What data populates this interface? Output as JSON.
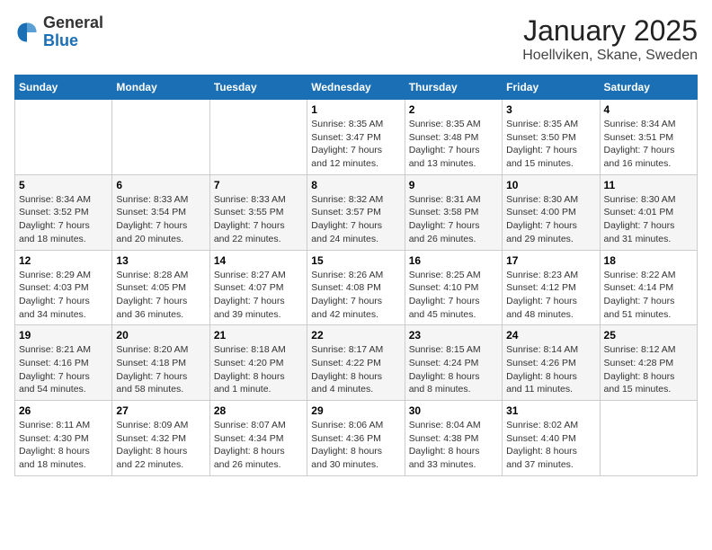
{
  "logo": {
    "general": "General",
    "blue": "Blue"
  },
  "title": "January 2025",
  "subtitle": "Hoellviken, Skane, Sweden",
  "weekdays": [
    "Sunday",
    "Monday",
    "Tuesday",
    "Wednesday",
    "Thursday",
    "Friday",
    "Saturday"
  ],
  "weeks": [
    [
      {
        "day": "",
        "content": ""
      },
      {
        "day": "",
        "content": ""
      },
      {
        "day": "",
        "content": ""
      },
      {
        "day": "1",
        "content": "Sunrise: 8:35 AM\nSunset: 3:47 PM\nDaylight: 7 hours\nand 12 minutes."
      },
      {
        "day": "2",
        "content": "Sunrise: 8:35 AM\nSunset: 3:48 PM\nDaylight: 7 hours\nand 13 minutes."
      },
      {
        "day": "3",
        "content": "Sunrise: 8:35 AM\nSunset: 3:50 PM\nDaylight: 7 hours\nand 15 minutes."
      },
      {
        "day": "4",
        "content": "Sunrise: 8:34 AM\nSunset: 3:51 PM\nDaylight: 7 hours\nand 16 minutes."
      }
    ],
    [
      {
        "day": "5",
        "content": "Sunrise: 8:34 AM\nSunset: 3:52 PM\nDaylight: 7 hours\nand 18 minutes."
      },
      {
        "day": "6",
        "content": "Sunrise: 8:33 AM\nSunset: 3:54 PM\nDaylight: 7 hours\nand 20 minutes."
      },
      {
        "day": "7",
        "content": "Sunrise: 8:33 AM\nSunset: 3:55 PM\nDaylight: 7 hours\nand 22 minutes."
      },
      {
        "day": "8",
        "content": "Sunrise: 8:32 AM\nSunset: 3:57 PM\nDaylight: 7 hours\nand 24 minutes."
      },
      {
        "day": "9",
        "content": "Sunrise: 8:31 AM\nSunset: 3:58 PM\nDaylight: 7 hours\nand 26 minutes."
      },
      {
        "day": "10",
        "content": "Sunrise: 8:30 AM\nSunset: 4:00 PM\nDaylight: 7 hours\nand 29 minutes."
      },
      {
        "day": "11",
        "content": "Sunrise: 8:30 AM\nSunset: 4:01 PM\nDaylight: 7 hours\nand 31 minutes."
      }
    ],
    [
      {
        "day": "12",
        "content": "Sunrise: 8:29 AM\nSunset: 4:03 PM\nDaylight: 7 hours\nand 34 minutes."
      },
      {
        "day": "13",
        "content": "Sunrise: 8:28 AM\nSunset: 4:05 PM\nDaylight: 7 hours\nand 36 minutes."
      },
      {
        "day": "14",
        "content": "Sunrise: 8:27 AM\nSunset: 4:07 PM\nDaylight: 7 hours\nand 39 minutes."
      },
      {
        "day": "15",
        "content": "Sunrise: 8:26 AM\nSunset: 4:08 PM\nDaylight: 7 hours\nand 42 minutes."
      },
      {
        "day": "16",
        "content": "Sunrise: 8:25 AM\nSunset: 4:10 PM\nDaylight: 7 hours\nand 45 minutes."
      },
      {
        "day": "17",
        "content": "Sunrise: 8:23 AM\nSunset: 4:12 PM\nDaylight: 7 hours\nand 48 minutes."
      },
      {
        "day": "18",
        "content": "Sunrise: 8:22 AM\nSunset: 4:14 PM\nDaylight: 7 hours\nand 51 minutes."
      }
    ],
    [
      {
        "day": "19",
        "content": "Sunrise: 8:21 AM\nSunset: 4:16 PM\nDaylight: 7 hours\nand 54 minutes."
      },
      {
        "day": "20",
        "content": "Sunrise: 8:20 AM\nSunset: 4:18 PM\nDaylight: 7 hours\nand 58 minutes."
      },
      {
        "day": "21",
        "content": "Sunrise: 8:18 AM\nSunset: 4:20 PM\nDaylight: 8 hours\nand 1 minute."
      },
      {
        "day": "22",
        "content": "Sunrise: 8:17 AM\nSunset: 4:22 PM\nDaylight: 8 hours\nand 4 minutes."
      },
      {
        "day": "23",
        "content": "Sunrise: 8:15 AM\nSunset: 4:24 PM\nDaylight: 8 hours\nand 8 minutes."
      },
      {
        "day": "24",
        "content": "Sunrise: 8:14 AM\nSunset: 4:26 PM\nDaylight: 8 hours\nand 11 minutes."
      },
      {
        "day": "25",
        "content": "Sunrise: 8:12 AM\nSunset: 4:28 PM\nDaylight: 8 hours\nand 15 minutes."
      }
    ],
    [
      {
        "day": "26",
        "content": "Sunrise: 8:11 AM\nSunset: 4:30 PM\nDaylight: 8 hours\nand 18 minutes."
      },
      {
        "day": "27",
        "content": "Sunrise: 8:09 AM\nSunset: 4:32 PM\nDaylight: 8 hours\nand 22 minutes."
      },
      {
        "day": "28",
        "content": "Sunrise: 8:07 AM\nSunset: 4:34 PM\nDaylight: 8 hours\nand 26 minutes."
      },
      {
        "day": "29",
        "content": "Sunrise: 8:06 AM\nSunset: 4:36 PM\nDaylight: 8 hours\nand 30 minutes."
      },
      {
        "day": "30",
        "content": "Sunrise: 8:04 AM\nSunset: 4:38 PM\nDaylight: 8 hours\nand 33 minutes."
      },
      {
        "day": "31",
        "content": "Sunrise: 8:02 AM\nSunset: 4:40 PM\nDaylight: 8 hours\nand 37 minutes."
      },
      {
        "day": "",
        "content": ""
      }
    ]
  ]
}
